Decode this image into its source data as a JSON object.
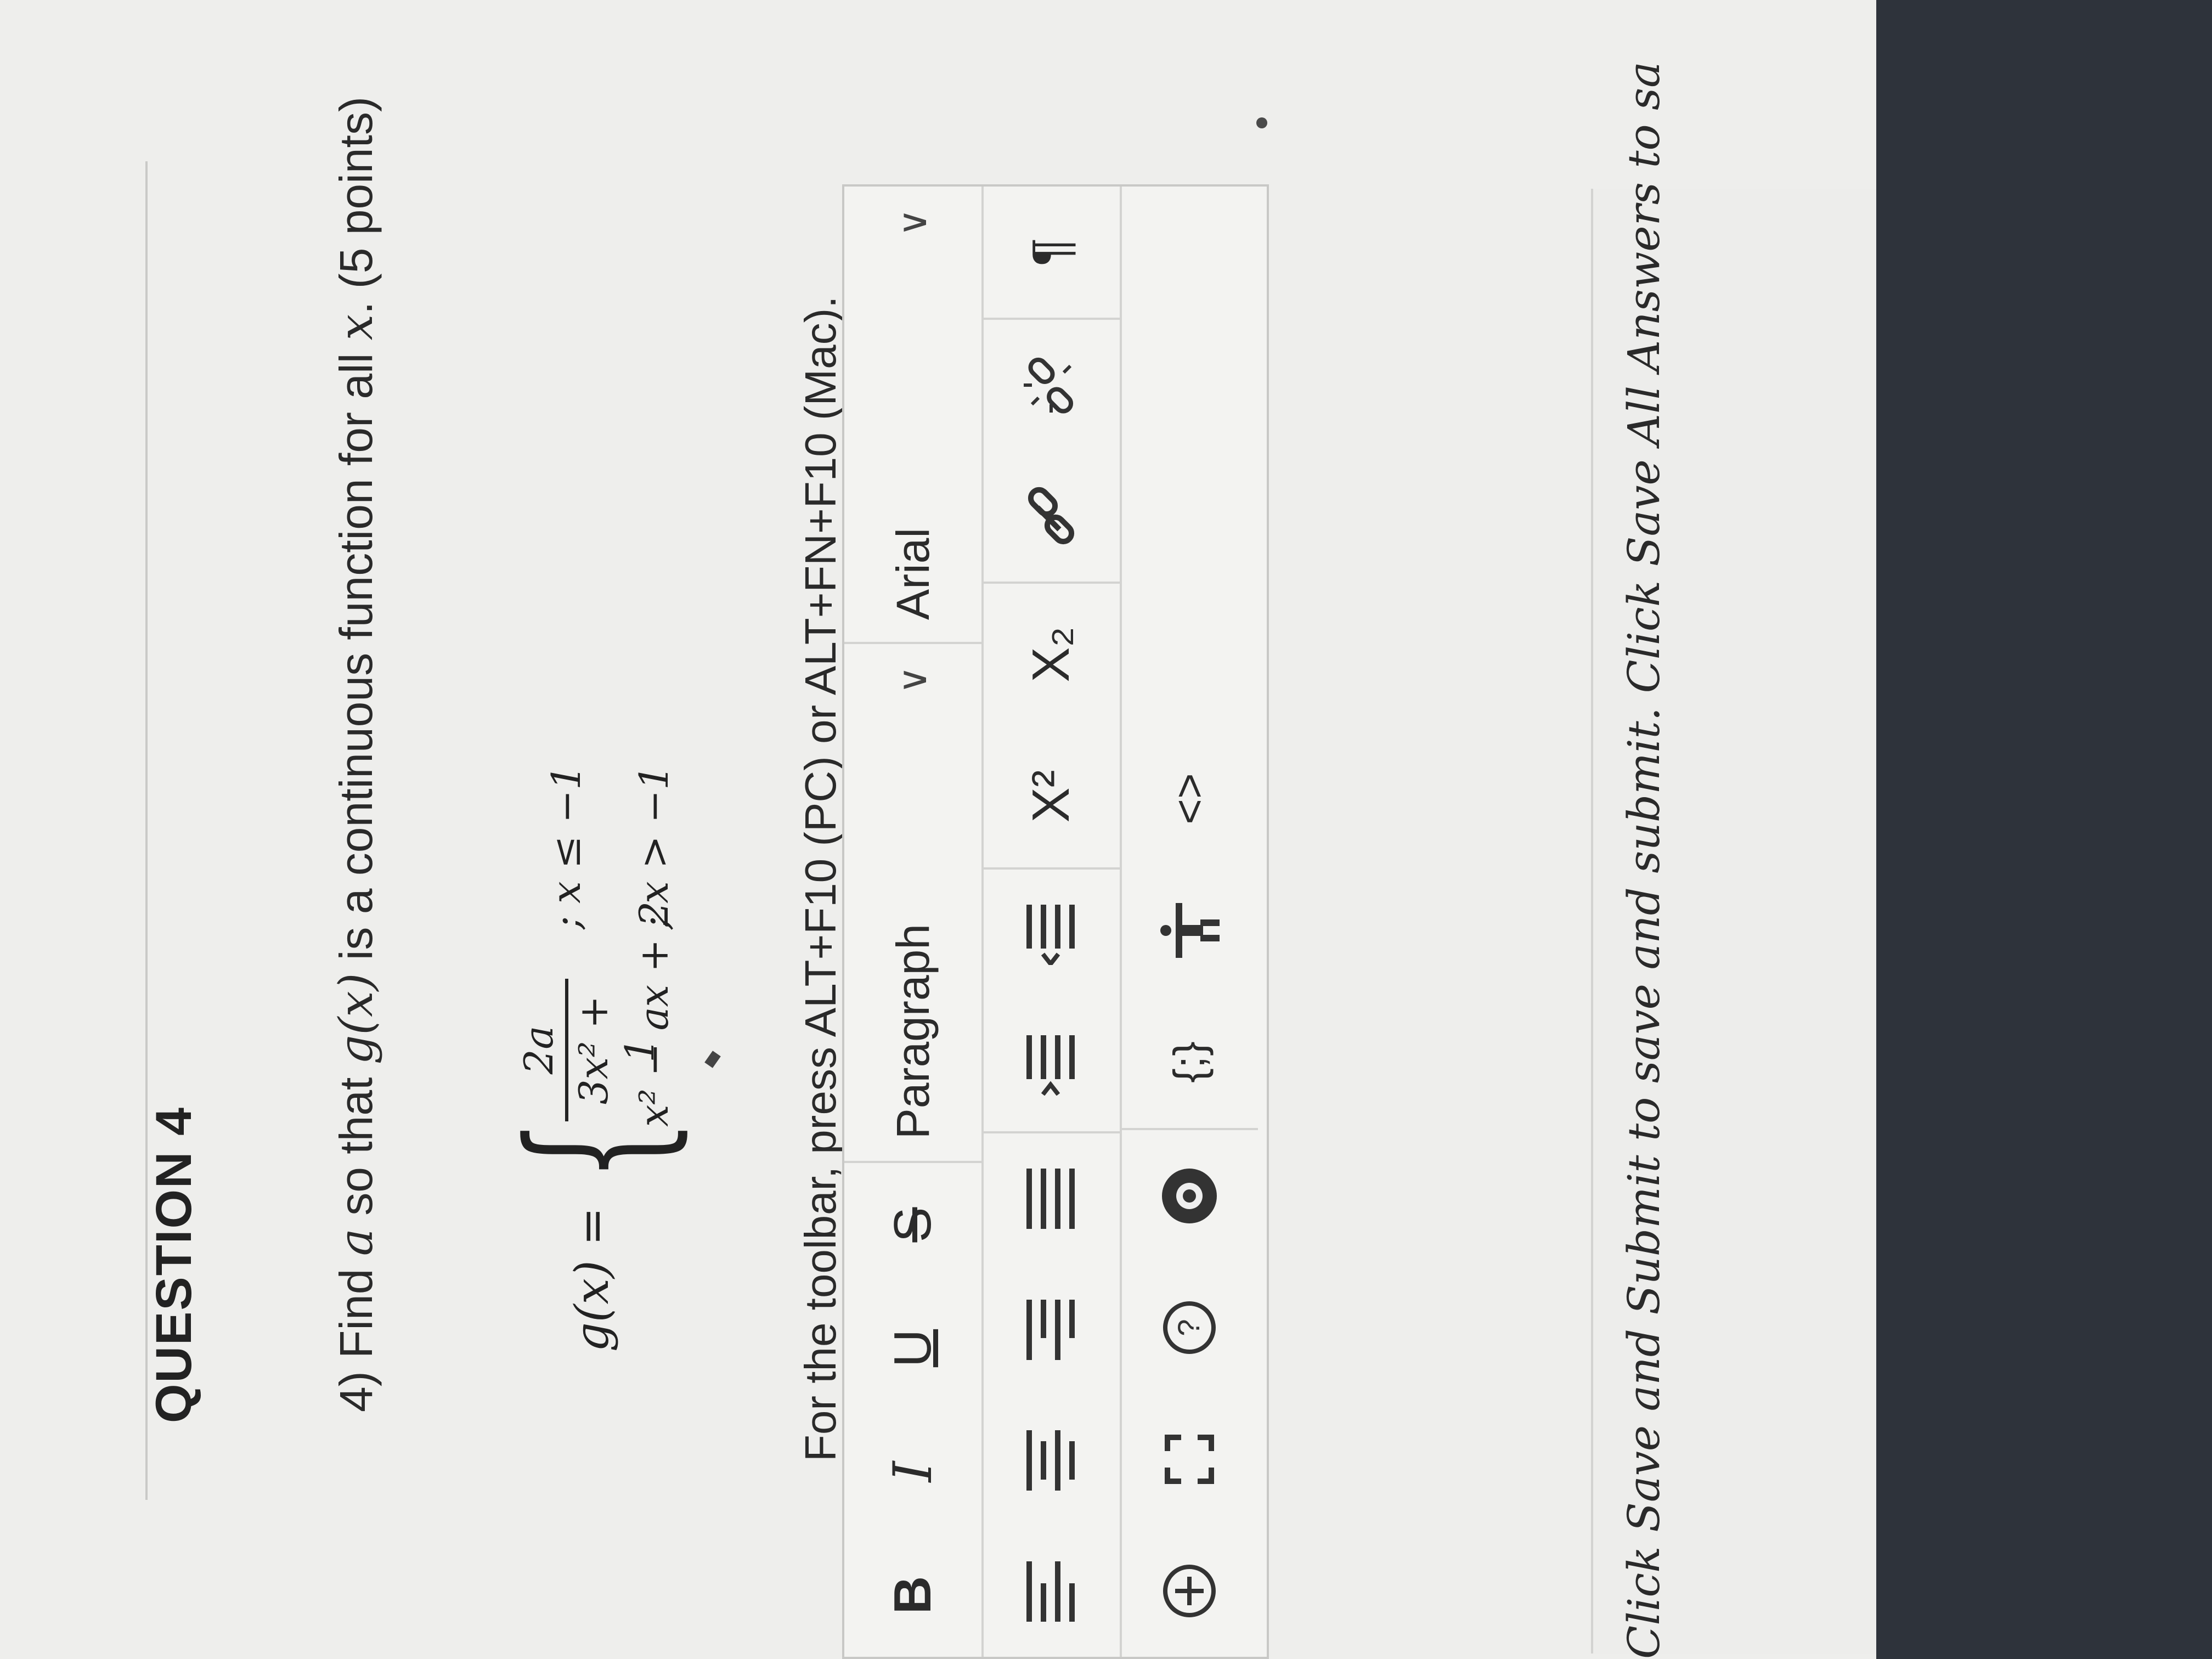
{
  "question": {
    "title": "QUESTION 4",
    "prompt_prefix": "4)  Find ",
    "prompt_var_a": "a",
    "prompt_mid": " so that ",
    "prompt_gx": "g(x)",
    "prompt_mid2": " is a continuous function for all ",
    "prompt_var_x": "x",
    "prompt_suffix": ". (5 points)"
  },
  "equation": {
    "lhs": "g(x) =",
    "case1_num": "2a",
    "case1_den": "3x² + 1",
    "case1_cond": "; x ≤ −1",
    "case2_expr": "x² − ax + 2",
    "case2_cond": "; x > −1"
  },
  "toolbar_hint": "For the toolbar, press ALT+F10 (PC) or ALT+FN+F10 (Mac).",
  "toolbar": {
    "bold": "B",
    "italic": "I",
    "underline": "U",
    "strikethrough": "S",
    "paragraph": "Paragraph",
    "font": "Arial",
    "superscript": "X²",
    "subscript": "X₂",
    "pilcrow": "¶"
  },
  "footer": "Click Save and Submit to save and submit. Click Save All Answers to sa"
}
